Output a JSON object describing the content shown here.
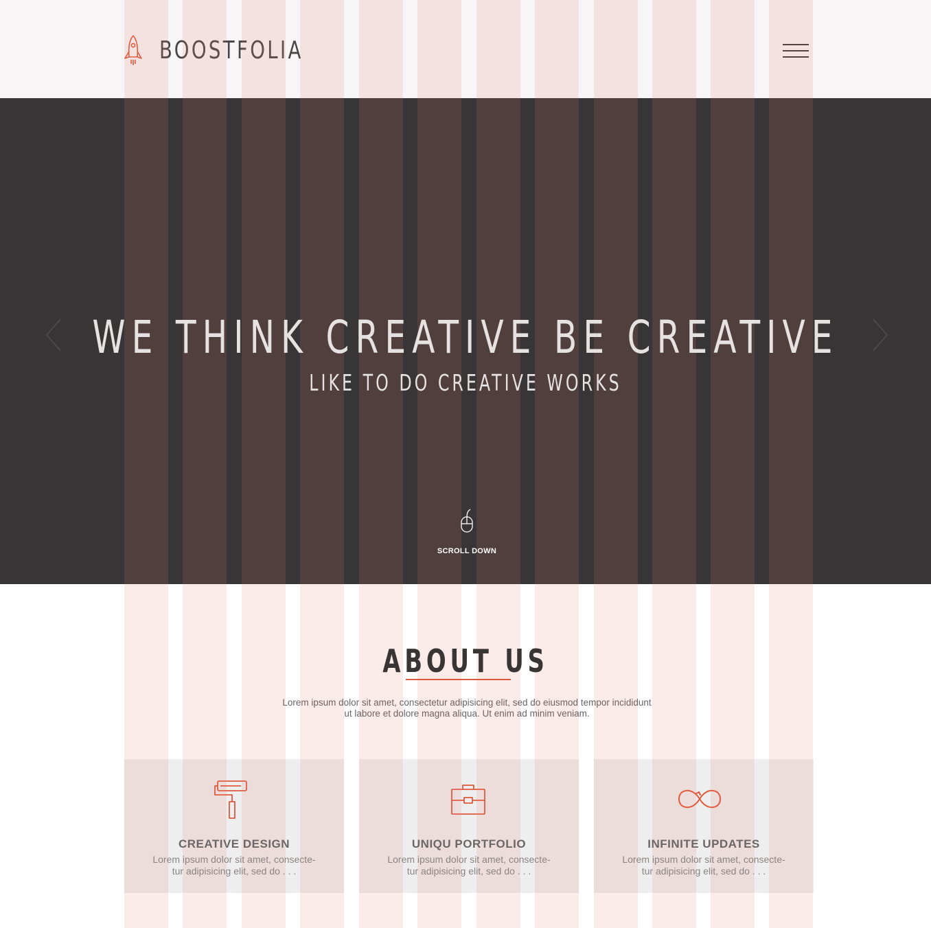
{
  "brand": {
    "name": "BOOSTFOLIA",
    "logo_icon": "rocket-icon",
    "accent_color": "#e0583a"
  },
  "header": {
    "menu_icon": "hamburger-menu-icon"
  },
  "hero": {
    "title": "WE THINK CREATIVE BE CREATIVE",
    "subtitle": "LIKE TO DO CREATIVE WORKS",
    "prev_icon": "chevron-left-icon",
    "next_icon": "chevron-right-icon",
    "scroll_icon": "mouse-icon",
    "scroll_label": "SCROLL DOWN"
  },
  "about": {
    "title": "ABOUT US",
    "text_line1": "Lorem ipsum dolor sit amet, consectetur adipisicing elit, sed do eiusmod tempor incididunt",
    "text_line2": "ut labore et dolore magna aliqua. Ut enim ad minim veniam."
  },
  "features": [
    {
      "icon": "paint-roller-icon",
      "title": "CREATIVE DESIGN",
      "line1": "Lorem ipsum dolor sit amet, consecte-",
      "line2": "tur adipisicing elit, sed do . . ."
    },
    {
      "icon": "briefcase-icon",
      "title": "UNIQU PORTFOLIO",
      "line1": "Lorem ipsum dolor sit amet, consecte-",
      "line2": "tur adipisicing elit, sed do . . ."
    },
    {
      "icon": "infinity-icon",
      "title": "INFINITE UPDATES",
      "line1": "Lorem ipsum dolor sit amet, consecte-",
      "line2": "tur adipisicing elit, sed do . . ."
    }
  ]
}
